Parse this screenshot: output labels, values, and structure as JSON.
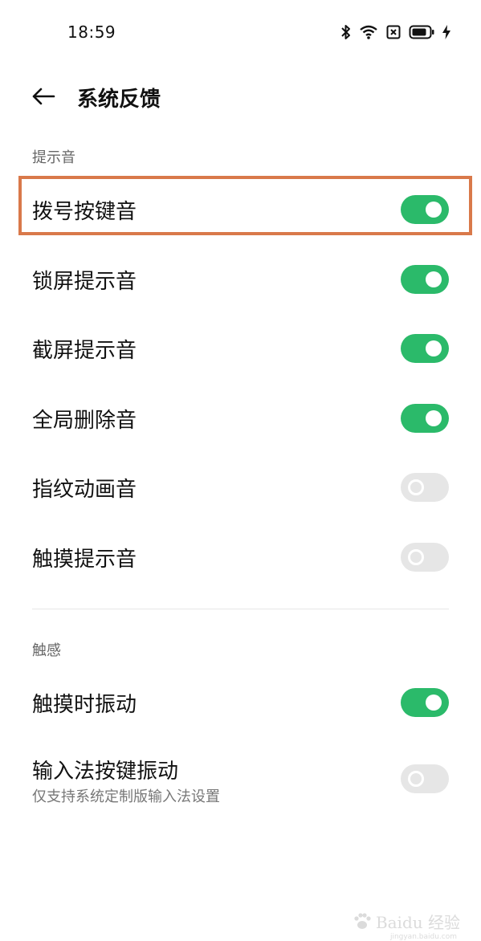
{
  "status_bar": {
    "time": "18:59",
    "icons": [
      "bluetooth-icon",
      "wifi-icon",
      "sim-off-icon",
      "battery-icon",
      "charging-icon"
    ]
  },
  "header": {
    "back_icon": "arrow-left-icon",
    "title": "系统反馈"
  },
  "sections": [
    {
      "title": "提示音",
      "items": [
        {
          "label": "拨号按键音",
          "on": true
        },
        {
          "label": "锁屏提示音",
          "on": true
        },
        {
          "label": "截屏提示音",
          "on": true
        },
        {
          "label": "全局删除音",
          "on": true
        },
        {
          "label": "指纹动画音",
          "on": false
        },
        {
          "label": "触摸提示音",
          "on": false
        }
      ]
    },
    {
      "title": "触感",
      "items": [
        {
          "label": "触摸时振动",
          "on": true
        },
        {
          "label": "输入法按键振动",
          "subtitle": "仅支持系统定制版输入法设置",
          "on": false
        }
      ]
    }
  ],
  "colors": {
    "toggle_on": "#2bba6a",
    "toggle_off": "#e6e6e6",
    "highlight": "#d9794a"
  },
  "watermark": {
    "text": "Baidu 经验",
    "sub": "jingyan.baidu.com"
  }
}
